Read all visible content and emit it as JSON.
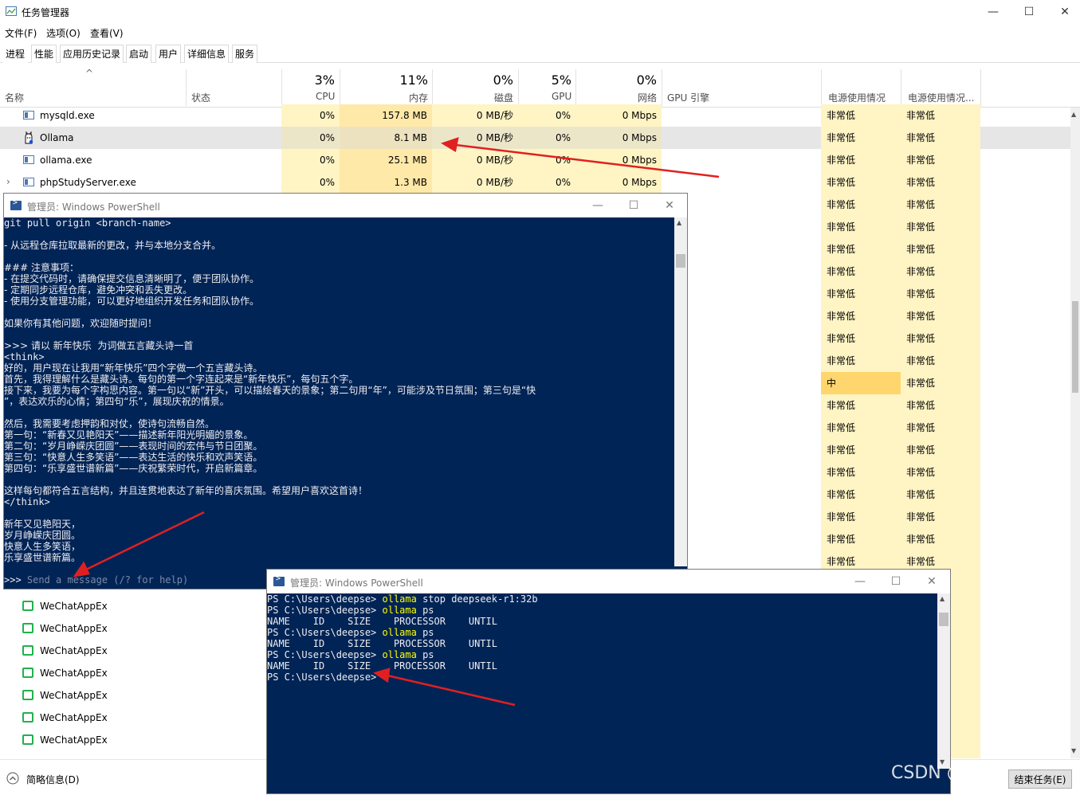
{
  "task_manager": {
    "title": "任务管理器",
    "window_controls": {
      "minimize": "—",
      "maximize": "☐",
      "close": "✕"
    },
    "menu": [
      "文件(F)",
      "选项(O)",
      "查看(V)"
    ],
    "tabs": [
      "进程",
      "性能",
      "应用历史记录",
      "启动",
      "用户",
      "详细信息",
      "服务"
    ],
    "columns": {
      "name": "名称",
      "status": "状态",
      "cpu_pct": "3%",
      "cpu": "CPU",
      "mem_pct": "11%",
      "mem": "内存",
      "disk_pct": "0%",
      "disk": "磁盘",
      "gpu_pct": "5%",
      "gpu": "GPU",
      "net_pct": "0%",
      "net": "网络",
      "gpu_engine": "GPU 引擎",
      "power": "电源使用情况",
      "power_trend": "电源使用情况..."
    },
    "processes": [
      {
        "name": "mysqld.exe",
        "cpu": "0%",
        "mem": "157.8 MB",
        "disk": "0 MB/秒",
        "gpu": "0%",
        "net": "0 Mbps",
        "power": "非常低",
        "power_trend": "非常低"
      },
      {
        "name": "Ollama",
        "cpu": "0%",
        "mem": "8.1 MB",
        "disk": "0 MB/秒",
        "gpu": "0%",
        "net": "0 Mbps",
        "power": "非常低",
        "power_trend": "非常低"
      },
      {
        "name": "ollama.exe",
        "cpu": "0%",
        "mem": "25.1 MB",
        "disk": "0 MB/秒",
        "gpu": "0%",
        "net": "0 Mbps",
        "power": "非常低",
        "power_trend": "非常低"
      },
      {
        "name": "phpStudyServer.exe",
        "cpu": "0%",
        "mem": "1.3 MB",
        "disk": "0 MB/秒",
        "gpu": "0%",
        "net": "0 Mbps",
        "power": "非常低",
        "power_trend": "非常低"
      }
    ],
    "power_column": [
      "非常低",
      "非常低",
      "非常低",
      "非常低",
      "非常低",
      "非常低",
      "非常低",
      "非常低",
      "非常低",
      "非常低",
      "非常低",
      "非常低",
      "中",
      "非常低",
      "非常低",
      "非常低",
      "非常低",
      "非常低",
      "非常低",
      "非常低",
      "非常低"
    ],
    "power_trend_column": [
      "非常低",
      "非常低",
      "非常低",
      "非常低",
      "非常低",
      "非常低",
      "非常低",
      "非常低",
      "非常低",
      "非常低",
      "非常低",
      "非常低",
      "非常低",
      "非常低",
      "非常低",
      "非常低",
      "非常低",
      "非常低",
      "非常低",
      "非常低",
      "非常低"
    ],
    "wechat_items": [
      "WeChatAppEx",
      "WeChatAppEx",
      "WeChatAppEx",
      "WeChatAppEx",
      "WeChatAppEx",
      "WeChatAppEx",
      "WeChatAppEx"
    ],
    "fewer_details": "简略信息(D)",
    "end_task": "结束任务(E)"
  },
  "ps1": {
    "title": "管理员: Windows PowerShell",
    "lines": [
      "git pull origin <branch-name>",
      "",
      "- 从远程仓库拉取最新的更改，并与本地分支合并。",
      "",
      "### 注意事项：",
      "- 在提交代码时，请确保提交信息清晰明了，便于团队协作。",
      "- 定期同步远程仓库，避免冲突和丢失更改。",
      "- 使用分支管理功能，可以更好地组织开发任务和团队协作。",
      "",
      "如果你有其他问题，欢迎随时提问！",
      "",
      ">>> 请以 新年快乐  为词做五言藏头诗一首",
      "<think>",
      "好的，用户现在让我用“新年快乐”四个字做一个五言藏头诗。",
      "首先，我得理解什么是藏头诗。每句的第一个字连起来是“新年快乐”，每句五个字。",
      "接下来，我要为每个字构思内容。第一句以“新”开头，可以描绘春天的景象；第二句用“年”，可能涉及节日氛围；第三句是“快",
      "”，表达欢乐的心情；第四句“乐”，展现庆祝的情景。",
      "",
      "然后，我需要考虑押韵和对仗，使诗句流畅自然。",
      "第一句：“新春又见艳阳天”——描述新年阳光明媚的景象。",
      "第二句：“岁月峥嵘庆团圆”——表现时间的宏伟与节日团聚。",
      "第三句：“快意人生多笑语”——表达生活的快乐和欢声笑语。",
      "第四句：“乐享盛世谱新篇”——庆祝繁荣时代，开启新篇章。",
      "",
      "这样每句都符合五言结构，并且连贯地表达了新年的喜庆氛围。希望用户喜欢这首诗！",
      "</think>",
      "",
      "新年又见艳阳天，",
      "岁月峥嵘庆团圆。",
      "快意人生多笑语，",
      "乐享盛世谱新篇。",
      ""
    ],
    "prompt": ">>> ",
    "prompt_hint": "Send a message (/? for help)"
  },
  "ps2": {
    "title": "管理员: Windows PowerShell",
    "lines": [
      {
        "prefix": "PS C:\\Users\\deepse> ",
        "cmd": "ollama",
        "rest": " stop deepseek-r1:32b"
      },
      {
        "prefix": "PS C:\\Users\\deepse> ",
        "cmd": "ollama",
        "rest": " ps"
      },
      {
        "prefix": "NAME    ID    SIZE    PROCESSOR    UNTIL",
        "cmd": "",
        "rest": ""
      },
      {
        "prefix": "PS C:\\Users\\deepse> ",
        "cmd": "ollama",
        "rest": " ps"
      },
      {
        "prefix": "NAME    ID    SIZE    PROCESSOR    UNTIL",
        "cmd": "",
        "rest": ""
      },
      {
        "prefix": "PS C:\\Users\\deepse> ",
        "cmd": "ollama",
        "rest": " ps"
      },
      {
        "prefix": "NAME    ID    SIZE    PROCESSOR    UNTIL",
        "cmd": "",
        "rest": ""
      },
      {
        "prefix": "PS C:\\Users\\deepse>",
        "cmd": "",
        "rest": ""
      }
    ]
  },
  "watermark": "CSDN @jess",
  "colors": {
    "ps_bg": "#012456",
    "power_low": "#fff4c4",
    "power_mid": "#ffd66e",
    "arrow": "#e02020"
  }
}
